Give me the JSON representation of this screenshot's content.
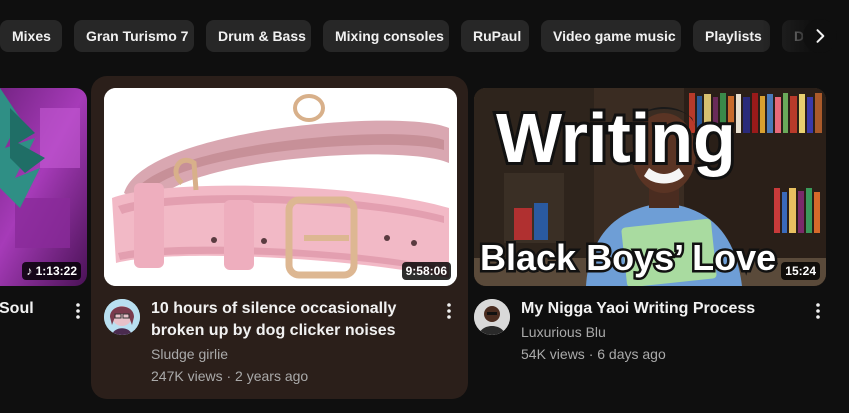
{
  "chips": [
    "Mixes",
    "Gran Turismo 7",
    "Drum & Bass",
    "Mixing consoles",
    "RuPaul",
    "Video game music",
    "Playlists",
    "Di"
  ],
  "videos": [
    {
      "title_line1": "",
      "title_line2": "Soul",
      "duration": "1:13:22"
    },
    {
      "title_line1": "10 hours of silence occasionally",
      "title_line2": "broken up by dog clicker noises",
      "channel": "Sludge girlie",
      "stats": "247K views · 2 years ago",
      "duration": "9:58:06"
    },
    {
      "title_line1": "My Nigga Yaoi Writing Process",
      "channel": "Luxurious Blu",
      "stats": "54K views · 6 days ago",
      "duration": "15:24",
      "thumb_text_top": "Writing",
      "thumb_text_bottom": "Black Boys’ Love"
    }
  ],
  "colors": {
    "background": "#0f0f0f",
    "chip": "#272727",
    "hover_card": "#2b1f1a",
    "progress": "#ff0033"
  },
  "icons": [
    "chevron-right-icon",
    "more-vert-icon"
  ]
}
